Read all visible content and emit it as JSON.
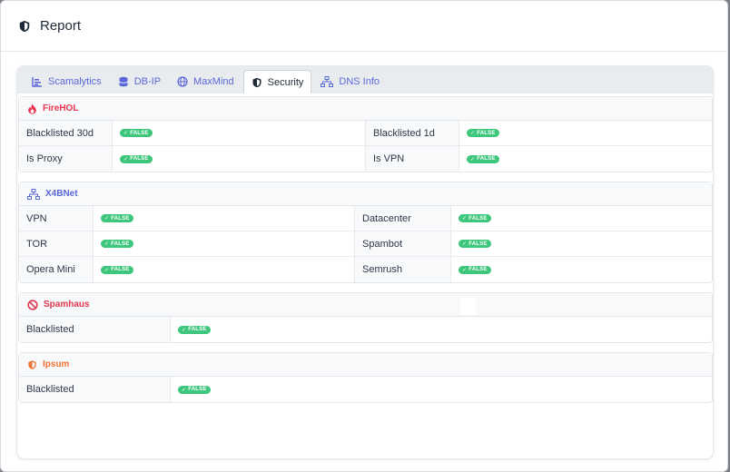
{
  "header": {
    "title": "Report"
  },
  "tabs": [
    {
      "label": "Scamalytics",
      "icon": "bar-chart-icon"
    },
    {
      "label": "DB-IP",
      "icon": "database-icon"
    },
    {
      "label": "MaxMind",
      "icon": "globe-icon"
    },
    {
      "label": "Security",
      "icon": "shield-icon"
    },
    {
      "label": "DNS Info",
      "icon": "network-icon"
    }
  ],
  "sections": {
    "firehol": {
      "title": "FireHOL",
      "color": "#e8344e",
      "rows": [
        {
          "l1": "Blacklisted 30d",
          "v1": "FALSE",
          "l2": "Blacklisted 1d",
          "v2": "FALSE"
        },
        {
          "l1": "Is Proxy",
          "v1": "FALSE",
          "l2": "Is VPN",
          "v2": "FALSE"
        }
      ]
    },
    "x4bnet": {
      "title": "X4BNet",
      "color": "#5a67d8",
      "rows": [
        {
          "l1": "VPN",
          "v1": "FALSE",
          "l2": "Datacenter",
          "v2": "FALSE"
        },
        {
          "l1": "TOR",
          "v1": "FALSE",
          "l2": "Spambot",
          "v2": "FALSE"
        },
        {
          "l1": "Opera Mini",
          "v1": "FALSE",
          "l2": "Semrush",
          "v2": "FALSE"
        }
      ]
    },
    "spamhaus": {
      "title": "Spamhaus",
      "color": "#e0364f",
      "rows": [
        {
          "l1": "Blacklisted",
          "v1": "FALSE"
        }
      ]
    },
    "ipsum": {
      "title": "Ipsum",
      "color": "#f07336",
      "rows": [
        {
          "l1": "Blacklisted",
          "v1": "FALSE"
        }
      ]
    }
  },
  "colors": {
    "accent": "#5a67d8",
    "badge": "#3ec77c"
  }
}
